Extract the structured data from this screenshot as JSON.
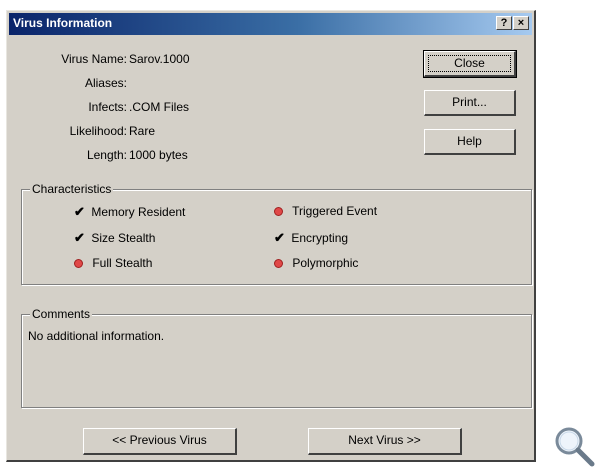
{
  "window": {
    "title": "Virus Information",
    "help_glyph": "?",
    "close_glyph": "×"
  },
  "info": {
    "virus_name_label": "Virus Name:",
    "virus_name_value": "Sarov.1000",
    "aliases_label": "Aliases:",
    "aliases_value": "",
    "infects_label": "Infects:",
    "infects_value": ".COM Files",
    "likelihood_label": "Likelihood:",
    "likelihood_value": "Rare",
    "length_label": "Length:",
    "length_value": "1000 bytes"
  },
  "buttons": {
    "close": "Close",
    "print": "Print...",
    "help": "Help"
  },
  "characteristics": {
    "title": "Characteristics",
    "items": [
      {
        "label": "Memory Resident",
        "state": "check"
      },
      {
        "label": "Triggered Event",
        "state": "dot"
      },
      {
        "label": "Size Stealth",
        "state": "check"
      },
      {
        "label": "Encrypting",
        "state": "check"
      },
      {
        "label": "Full Stealth",
        "state": "dot"
      },
      {
        "label": "Polymorphic",
        "state": "dot"
      }
    ],
    "check_glyph": "✔"
  },
  "comments": {
    "title": "Comments",
    "text": "No additional information."
  },
  "nav": {
    "previous": "<< Previous Virus",
    "next": "Next Virus >>"
  },
  "colors": {
    "dialog_bg": "#d4d0c8",
    "title_start": "#0a246a",
    "title_end": "#a6caf0",
    "dot_red": "#e04848"
  }
}
